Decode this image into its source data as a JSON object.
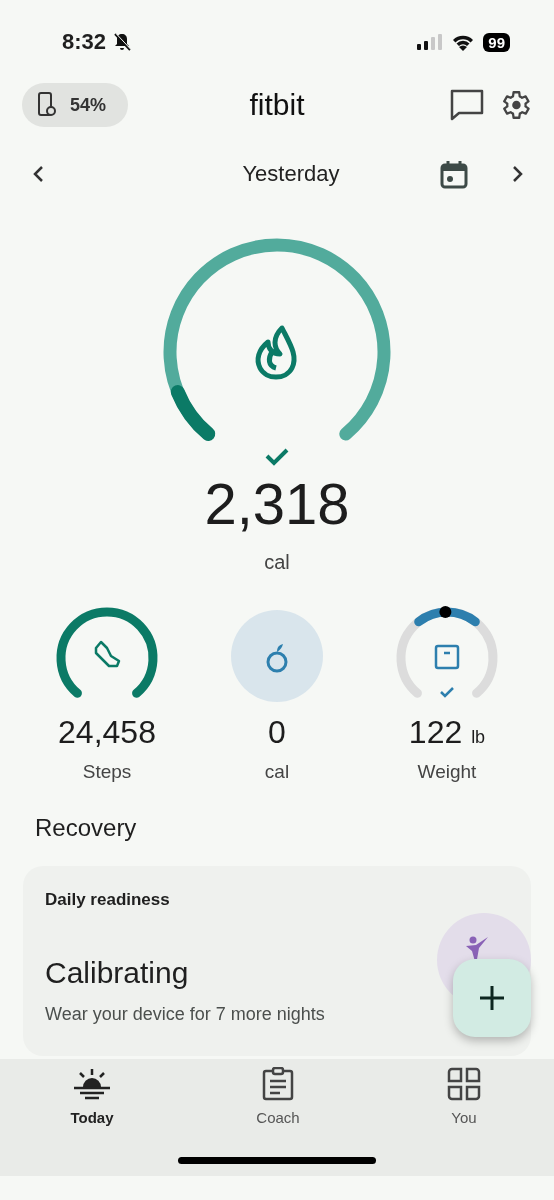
{
  "status_bar": {
    "time": "8:32",
    "battery": "99"
  },
  "header": {
    "device_battery": "54%",
    "title": "fitbit"
  },
  "date_nav": {
    "label": "Yesterday"
  },
  "calories": {
    "value": "2,318",
    "unit": "cal",
    "goal_met": true
  },
  "stats": [
    {
      "kind": "steps",
      "value": "24,458",
      "label": "Steps"
    },
    {
      "kind": "food",
      "value": "0",
      "label": "cal"
    },
    {
      "kind": "weight",
      "value": "122",
      "unit": "lb",
      "label": "Weight",
      "goal_met": true
    }
  ],
  "section_title": "Recovery",
  "readiness_card": {
    "title": "Daily readiness",
    "status": "Calibrating",
    "message": "Wear your device for 7 more nights"
  },
  "nav": [
    {
      "kind": "today",
      "label": "Today",
      "selected": true
    },
    {
      "kind": "coach",
      "label": "Coach",
      "selected": false
    },
    {
      "kind": "you",
      "label": "You",
      "selected": false
    }
  ]
}
